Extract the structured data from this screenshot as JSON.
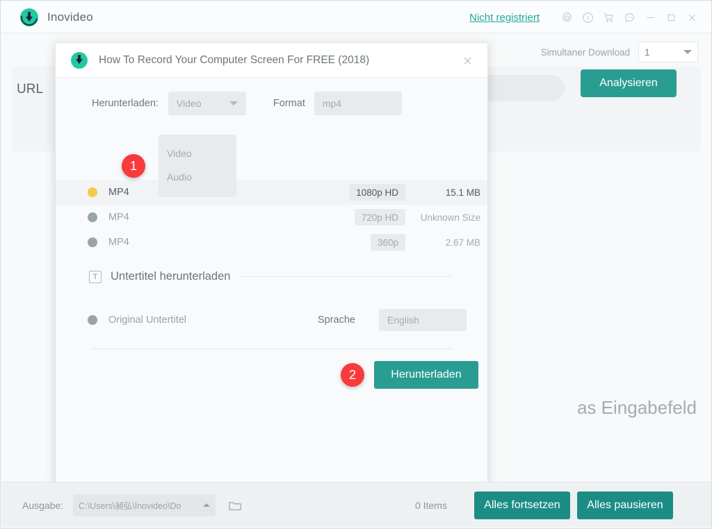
{
  "titlebar": {
    "app_name": "Inovideo",
    "logo_icon": "download-circle-logo",
    "register_link": "Nicht registriert",
    "icons": [
      {
        "name": "gear-icon",
        "glyph": "settings"
      },
      {
        "name": "info-icon",
        "glyph": "info"
      },
      {
        "name": "cart-icon",
        "glyph": "cart"
      },
      {
        "name": "feedback-icon",
        "glyph": "chat"
      },
      {
        "name": "minimize-icon",
        "glyph": "minimize"
      },
      {
        "name": "maximize-icon",
        "glyph": "maximize"
      },
      {
        "name": "close-icon",
        "glyph": "close"
      }
    ]
  },
  "main": {
    "simultaneous_label": "Simultaner Download",
    "simultaneous_value": "1",
    "url_label": "URL",
    "url_value": "",
    "analyze_button": "Analysieren",
    "hint_text": "as Eingabefeld"
  },
  "modal": {
    "title": "How To Record Your Computer Screen For FREE (2018)",
    "close_icon": "close-icon",
    "download_label": "Herunterladen:",
    "download_value": "Video",
    "format_label": "Format",
    "format_value": "mp4",
    "dropdown_options": [
      "Video",
      "Audio"
    ],
    "quality_rows": [
      {
        "format": "MP4",
        "resolution": "1080p HD",
        "size": "15.1 MB",
        "selected": true
      },
      {
        "format": "MP4",
        "resolution": "720p HD",
        "size": "Unknown Size",
        "selected": false
      },
      {
        "format": "MP4",
        "resolution": "360p",
        "size": "2.67 MB",
        "selected": false
      }
    ],
    "subtitle_section_title": "Untertitel herunterladen",
    "subtitle_icon": "text-subtitle-icon",
    "subtitle_option": "Original Untertitel",
    "language_label": "Sprache",
    "language_value": "English",
    "download_button": "Herunterladen",
    "markers": [
      {
        "label": "1"
      },
      {
        "label": "2"
      }
    ]
  },
  "bottombar": {
    "output_label": "Ausgabe:",
    "output_path": "C:\\Users\\昶弘\\Inovideo\\Do",
    "folder_icon": "folder-icon",
    "items_count": "0 Items",
    "resume_all_button": "Alles fortsetzen",
    "pause_all_button": "Alles pausieren"
  },
  "colors": {
    "accent_teal": "#2a9d92",
    "brand_green": "#20c9a0",
    "marker_red": "#f93a3a",
    "selected_radio": "#f7c84b"
  }
}
